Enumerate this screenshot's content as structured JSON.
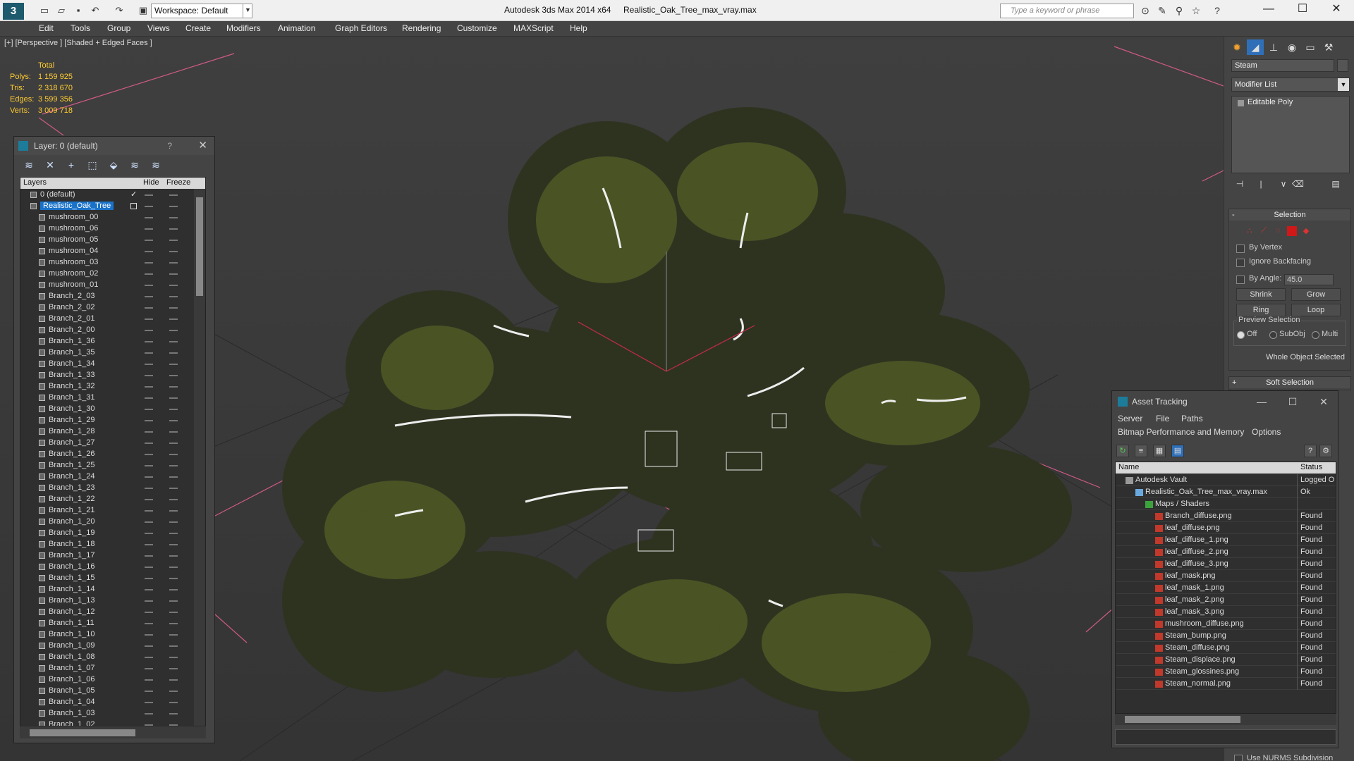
{
  "window": {
    "app_title": "Autodesk 3ds Max  2014 x64",
    "file_title": "Realistic_Oak_Tree_max_vray.max",
    "workspace": "Workspace: Default",
    "search_placeholder": "Type a keyword or phrase",
    "minimize": "—",
    "maximize": "☐",
    "close": "✕"
  },
  "menu": [
    "Edit",
    "Tools",
    "Group",
    "Views",
    "Create",
    "Modifiers",
    "Animation",
    "Graph Editors",
    "Rendering",
    "Customize",
    "MAXScript",
    "Help"
  ],
  "viewport": {
    "label": "[+] [Perspective ] [Shaded + Edged Faces ]",
    "stats": {
      "heading": "Total",
      "rows": [
        {
          "k": "Polys:",
          "v": "1 159 925"
        },
        {
          "k": "Tris:",
          "v": "2 318 670"
        },
        {
          "k": "Edges:",
          "v": "3 599 356"
        },
        {
          "k": "Verts:",
          "v": "3 009 718"
        }
      ]
    }
  },
  "layer_dialog": {
    "title": "Layer: 0 (default)",
    "help": "?",
    "close": "✕",
    "columns": {
      "layers": "Layers",
      "hide": "Hide",
      "freeze": "Freeze"
    },
    "rows": [
      {
        "name": "0 (default)",
        "level": 0,
        "state": "current"
      },
      {
        "name": "Realistic_Oak_Tree",
        "level": 0,
        "state": "selected"
      },
      {
        "name": "mushroom_00",
        "level": 1
      },
      {
        "name": "mushroom_06",
        "level": 1
      },
      {
        "name": "mushroom_05",
        "level": 1
      },
      {
        "name": "mushroom_04",
        "level": 1
      },
      {
        "name": "mushroom_03",
        "level": 1
      },
      {
        "name": "mushroom_02",
        "level": 1
      },
      {
        "name": "mushroom_01",
        "level": 1
      },
      {
        "name": "Branch_2_03",
        "level": 1
      },
      {
        "name": "Branch_2_02",
        "level": 1
      },
      {
        "name": "Branch_2_01",
        "level": 1
      },
      {
        "name": "Branch_2_00",
        "level": 1
      },
      {
        "name": "Branch_1_36",
        "level": 1
      },
      {
        "name": "Branch_1_35",
        "level": 1
      },
      {
        "name": "Branch_1_34",
        "level": 1
      },
      {
        "name": "Branch_1_33",
        "level": 1
      },
      {
        "name": "Branch_1_32",
        "level": 1
      },
      {
        "name": "Branch_1_31",
        "level": 1
      },
      {
        "name": "Branch_1_30",
        "level": 1
      },
      {
        "name": "Branch_1_29",
        "level": 1
      },
      {
        "name": "Branch_1_28",
        "level": 1
      },
      {
        "name": "Branch_1_27",
        "level": 1
      },
      {
        "name": "Branch_1_26",
        "level": 1
      },
      {
        "name": "Branch_1_25",
        "level": 1
      },
      {
        "name": "Branch_1_24",
        "level": 1
      },
      {
        "name": "Branch_1_23",
        "level": 1
      },
      {
        "name": "Branch_1_22",
        "level": 1
      },
      {
        "name": "Branch_1_21",
        "level": 1
      },
      {
        "name": "Branch_1_20",
        "level": 1
      },
      {
        "name": "Branch_1_19",
        "level": 1
      },
      {
        "name": "Branch_1_18",
        "level": 1
      },
      {
        "name": "Branch_1_17",
        "level": 1
      },
      {
        "name": "Branch_1_16",
        "level": 1
      },
      {
        "name": "Branch_1_15",
        "level": 1
      },
      {
        "name": "Branch_1_14",
        "level": 1
      },
      {
        "name": "Branch_1_13",
        "level": 1
      },
      {
        "name": "Branch_1_12",
        "level": 1
      },
      {
        "name": "Branch_1_11",
        "level": 1
      },
      {
        "name": "Branch_1_10",
        "level": 1
      },
      {
        "name": "Branch_1_09",
        "level": 1
      },
      {
        "name": "Branch_1_08",
        "level": 1
      },
      {
        "name": "Branch_1_07",
        "level": 1
      },
      {
        "name": "Branch_1_06",
        "level": 1
      },
      {
        "name": "Branch_1_05",
        "level": 1
      },
      {
        "name": "Branch_1_04",
        "level": 1
      },
      {
        "name": "Branch_1_03",
        "level": 1
      },
      {
        "name": "Branch_1_02",
        "level": 1
      }
    ]
  },
  "command_panel": {
    "object_name": "Steam",
    "modifier_list": "Modifier List",
    "stack": [
      "Editable Poly"
    ],
    "selection": {
      "title": "Selection",
      "by_vertex": "By Vertex",
      "ignore_backfacing": "Ignore Backfacing",
      "by_angle": "By Angle:",
      "angle_value": "45.0",
      "shrink": "Shrink",
      "grow": "Grow",
      "ring": "Ring",
      "loop": "Loop",
      "preview_title": "Preview Selection",
      "preview_options": [
        "Off",
        "SubObj",
        "Multi"
      ],
      "status": "Whole Object Selected"
    },
    "soft_selection": "Soft Selection",
    "nurbs": "Use NURMS Subdivision"
  },
  "asset_dialog": {
    "title": "Asset Tracking",
    "menu_row1": [
      "Server",
      "File",
      "Paths"
    ],
    "menu_row2": [
      "Bitmap Performance and Memory",
      "Options"
    ],
    "columns": {
      "name": "Name",
      "status": "Status"
    },
    "rows": [
      {
        "name": "Autodesk Vault",
        "status": "Logged O",
        "level": 0,
        "kind": "vault"
      },
      {
        "name": "Realistic_Oak_Tree_max_vray.max",
        "status": "Ok",
        "level": 1,
        "kind": "file"
      },
      {
        "name": "Maps / Shaders",
        "status": "",
        "level": 2,
        "kind": "maps"
      },
      {
        "name": "Branch_diffuse.png",
        "status": "Found",
        "level": 3,
        "kind": "png"
      },
      {
        "name": "leaf_diffuse.png",
        "status": "Found",
        "level": 3,
        "kind": "png"
      },
      {
        "name": "leaf_diffuse_1.png",
        "status": "Found",
        "level": 3,
        "kind": "png"
      },
      {
        "name": "leaf_diffuse_2.png",
        "status": "Found",
        "level": 3,
        "kind": "png"
      },
      {
        "name": "leaf_diffuse_3.png",
        "status": "Found",
        "level": 3,
        "kind": "png"
      },
      {
        "name": "leaf_mask.png",
        "status": "Found",
        "level": 3,
        "kind": "png"
      },
      {
        "name": "leaf_mask_1.png",
        "status": "Found",
        "level": 3,
        "kind": "png"
      },
      {
        "name": "leaf_mask_2.png",
        "status": "Found",
        "level": 3,
        "kind": "png"
      },
      {
        "name": "leaf_mask_3.png",
        "status": "Found",
        "level": 3,
        "kind": "png"
      },
      {
        "name": "mushroom_diffuse.png",
        "status": "Found",
        "level": 3,
        "kind": "png"
      },
      {
        "name": "Steam_bump.png",
        "status": "Found",
        "level": 3,
        "kind": "png"
      },
      {
        "name": "Steam_diffuse.png",
        "status": "Found",
        "level": 3,
        "kind": "png"
      },
      {
        "name": "Steam_displace.png",
        "status": "Found",
        "level": 3,
        "kind": "png"
      },
      {
        "name": "Steam_glossines.png",
        "status": "Found",
        "level": 3,
        "kind": "png"
      },
      {
        "name": "Steam_normal.png",
        "status": "Found",
        "level": 3,
        "kind": "png"
      }
    ]
  },
  "colors": {
    "accent_selection": "#1a72c8",
    "stats_text": "#ffcc33",
    "foliage": "#2e3320",
    "png_icon": "#c0392b"
  }
}
